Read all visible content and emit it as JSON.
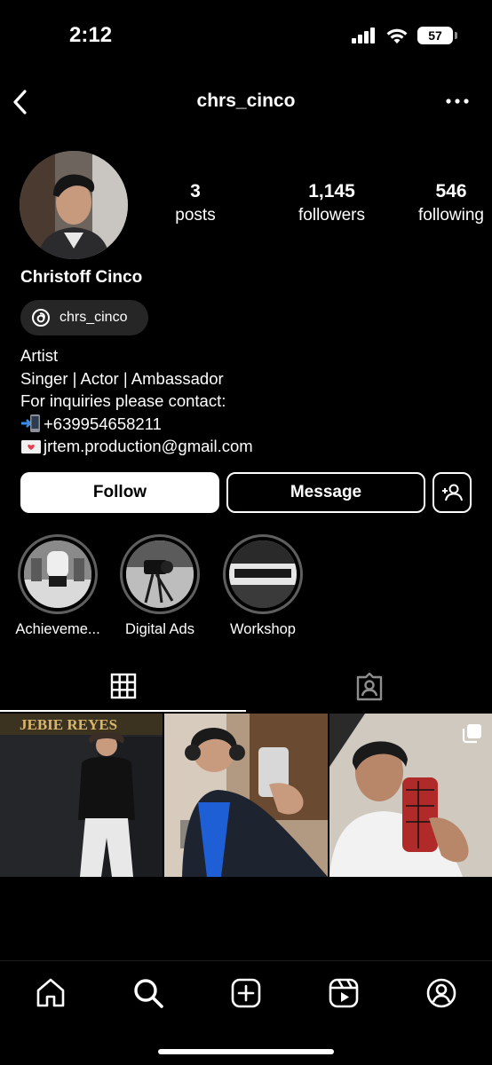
{
  "status": {
    "time": "2:12",
    "battery": "57"
  },
  "header": {
    "username": "chrs_cinco"
  },
  "profile": {
    "stats": [
      {
        "num": "3",
        "label": "posts"
      },
      {
        "num": "1,145",
        "label": "followers"
      },
      {
        "num": "546",
        "label": "following"
      }
    ],
    "display_name": "Christoff Cinco",
    "threads_handle": "chrs_cinco",
    "bio": {
      "line1": "Artist",
      "line2": "Singer | Actor | Ambassador",
      "line3": "For inquiries please contact:",
      "phone": "+639954658211",
      "email": "jrtem.production@gmail.com"
    }
  },
  "actions": {
    "follow": "Follow",
    "message": "Message"
  },
  "highlights": [
    {
      "label": "Achieveme..."
    },
    {
      "label": "Digital Ads"
    },
    {
      "label": "Workshop"
    }
  ],
  "posts": {
    "sign_text": "JEBIE REYES"
  },
  "icons": {
    "back": "chevron-left-icon",
    "more": "more-horizontal-icon",
    "threads": "threads-icon",
    "add_user": "add-user-icon",
    "grid": "grid-icon",
    "tagged": "tagged-icon",
    "home": "home-icon",
    "search": "search-icon",
    "create": "create-icon",
    "reels": "reels-icon",
    "profile": "profile-icon"
  }
}
